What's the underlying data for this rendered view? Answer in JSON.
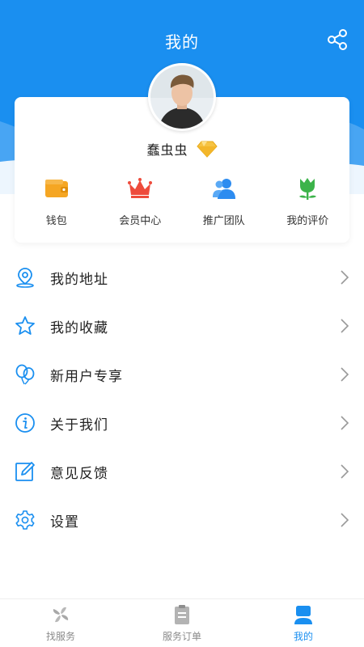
{
  "header": {
    "title": "我的"
  },
  "profile": {
    "username": "蠢虫虫"
  },
  "quick_actions": [
    {
      "label": "钱包",
      "icon": "wallet-icon",
      "color": "#f5a623"
    },
    {
      "label": "会员中心",
      "icon": "crown-icon",
      "color": "#ee4b3c"
    },
    {
      "label": "推广团队",
      "icon": "team-icon",
      "color": "#2d8cf0"
    },
    {
      "label": "我的评价",
      "icon": "tulip-icon",
      "color": "#3cb34a"
    }
  ],
  "menu": [
    {
      "label": "我的地址",
      "icon": "location-pin-icon"
    },
    {
      "label": "我的收藏",
      "icon": "star-icon"
    },
    {
      "label": "新用户专享",
      "icon": "balloon-icon"
    },
    {
      "label": "关于我们",
      "icon": "info-icon"
    },
    {
      "label": "意见反馈",
      "icon": "edit-icon"
    },
    {
      "label": "设置",
      "icon": "gear-icon"
    }
  ],
  "tabbar": [
    {
      "label": "找服务",
      "icon": "pinwheel-icon",
      "active": false
    },
    {
      "label": "服务订单",
      "icon": "clipboard-icon",
      "active": false
    },
    {
      "label": "我的",
      "icon": "user-icon",
      "active": true
    }
  ],
  "colors": {
    "primary": "#1a8ff0",
    "text": "#222222",
    "muted": "#8a8a8a"
  }
}
